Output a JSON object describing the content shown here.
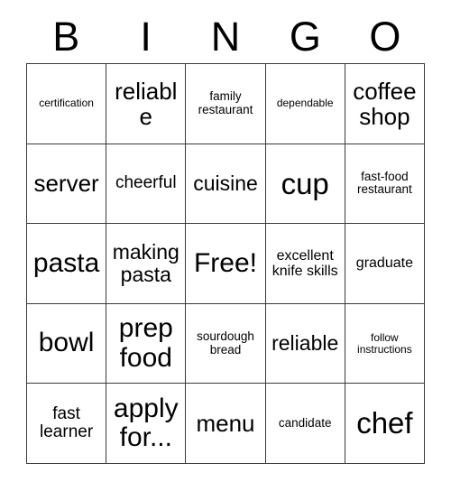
{
  "card": {
    "header_letters": [
      "B",
      "I",
      "N",
      "G",
      "O"
    ],
    "columns": 5,
    "rows": 5,
    "border_color": "#3a3a3a",
    "background_color": "#ffffff",
    "text_color": "#000000",
    "free_space": "Free!",
    "cells": [
      [
        {
          "text": "certification",
          "size": "xs"
        },
        {
          "text": "reliable",
          "size": "2xl"
        },
        {
          "text": "family restaurant",
          "size": "sm"
        },
        {
          "text": "dependable",
          "size": "xs"
        },
        {
          "text": "coffee shop",
          "size": "2xl"
        }
      ],
      [
        {
          "text": "server",
          "size": "2xl"
        },
        {
          "text": "cheerful",
          "size": "lg"
        },
        {
          "text": "cuisine",
          "size": "xl"
        },
        {
          "text": "cup",
          "size": "4xl"
        },
        {
          "text": "fast-food restaurant",
          "size": "sm"
        }
      ],
      [
        {
          "text": "pasta",
          "size": "3xl"
        },
        {
          "text": "making pasta",
          "size": "xl"
        },
        {
          "text": "Free!",
          "size": "3xl"
        },
        {
          "text": "excellent knife skills",
          "size": "md"
        },
        {
          "text": "graduate",
          "size": "md"
        }
      ],
      [
        {
          "text": "bowl",
          "size": "3xl"
        },
        {
          "text": "prep food",
          "size": "3xl"
        },
        {
          "text": "sourdough bread",
          "size": "sm"
        },
        {
          "text": "reliable",
          "size": "xl"
        },
        {
          "text": "follow instructions",
          "size": "xs"
        }
      ],
      [
        {
          "text": "fast learner",
          "size": "lg"
        },
        {
          "text": "apply for...",
          "size": "3xl"
        },
        {
          "text": "menu",
          "size": "2xl"
        },
        {
          "text": "candidate",
          "size": "sm"
        },
        {
          "text": "chef",
          "size": "4xl"
        }
      ]
    ]
  }
}
